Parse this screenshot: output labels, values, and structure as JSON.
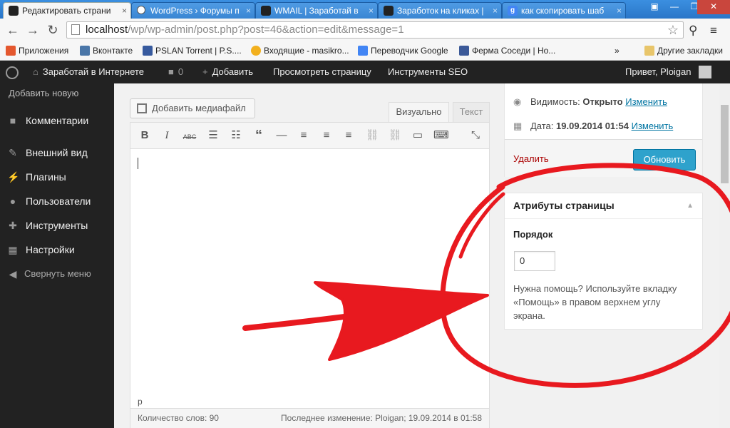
{
  "browser": {
    "tabs": [
      {
        "title": "Редактировать страни",
        "active": true
      },
      {
        "title": "WordPress › Форумы п",
        "active": false
      },
      {
        "title": "WMAIL | Заработай в",
        "active": false
      },
      {
        "title": "Заработок на кликах |",
        "active": false
      },
      {
        "title": "как скопировать шаб",
        "active": false
      }
    ],
    "url_host": "localhost",
    "url_path": "/wp/wp-admin/post.php?post=46&action=edit&message=1",
    "bookmarks": [
      {
        "label": "Приложения",
        "icon": "apps-icon"
      },
      {
        "label": "Вконтакте",
        "icon": "vk-icon"
      },
      {
        "label": "PSLAN Torrent | P.S....",
        "icon": "pslan-icon"
      },
      {
        "label": "Входящие - masikro...",
        "icon": "mail-icon"
      },
      {
        "label": "Переводчик Google",
        "icon": "translate-icon"
      },
      {
        "label": "Ферма Соседи | Но...",
        "icon": "farm-icon"
      }
    ],
    "more_bookmarks": "»",
    "other_bookmarks": "Другие закладки"
  },
  "adminbar": {
    "site_name": "Заработай в Интернете",
    "comments_count": "0",
    "add_new": "Добавить",
    "view_page": "Просмотреть страницу",
    "seo_tools": "Инструменты SEO",
    "greeting": "Привет, Ploigan"
  },
  "sidebar": {
    "sub_item": "Добавить новую",
    "items": [
      {
        "label": "Комментарии",
        "icon": "comment-icon"
      },
      {
        "label": "Внешний вид",
        "icon": "brush-icon"
      },
      {
        "label": "Плагины",
        "icon": "plugin-icon"
      },
      {
        "label": "Пользователи",
        "icon": "users-icon"
      },
      {
        "label": "Инструменты",
        "icon": "wrench-icon"
      },
      {
        "label": "Настройки",
        "icon": "settings-icon"
      }
    ],
    "collapse": "Свернуть меню"
  },
  "editor": {
    "add_media": "Добавить медиафайл",
    "tab_visual": "Визуально",
    "tab_text": "Текст",
    "path": "p",
    "word_count": "Количество слов: 90",
    "last_edited": "Последнее изменение: Ploigan; 19.09.2014 в 01:58"
  },
  "publish": {
    "visibility_label": "Видимость:",
    "visibility_value": "Открыто",
    "visibility_edit": "Изменить",
    "date_label": "Дата:",
    "date_value": "19.09.2014 01:54",
    "date_edit": "Изменить",
    "delete": "Удалить",
    "update": "Обновить"
  },
  "page_attributes": {
    "title": "Атрибуты страницы",
    "order_label": "Порядок",
    "order_value": "0",
    "help": "Нужна помощь? Используйте вкладку «Помощь» в правом верхнем углу экрана."
  },
  "colors": {
    "admin_bar": "#222222",
    "accent": "#2ea2cc",
    "link": "#0074a2",
    "annotation": "#e8191f"
  }
}
